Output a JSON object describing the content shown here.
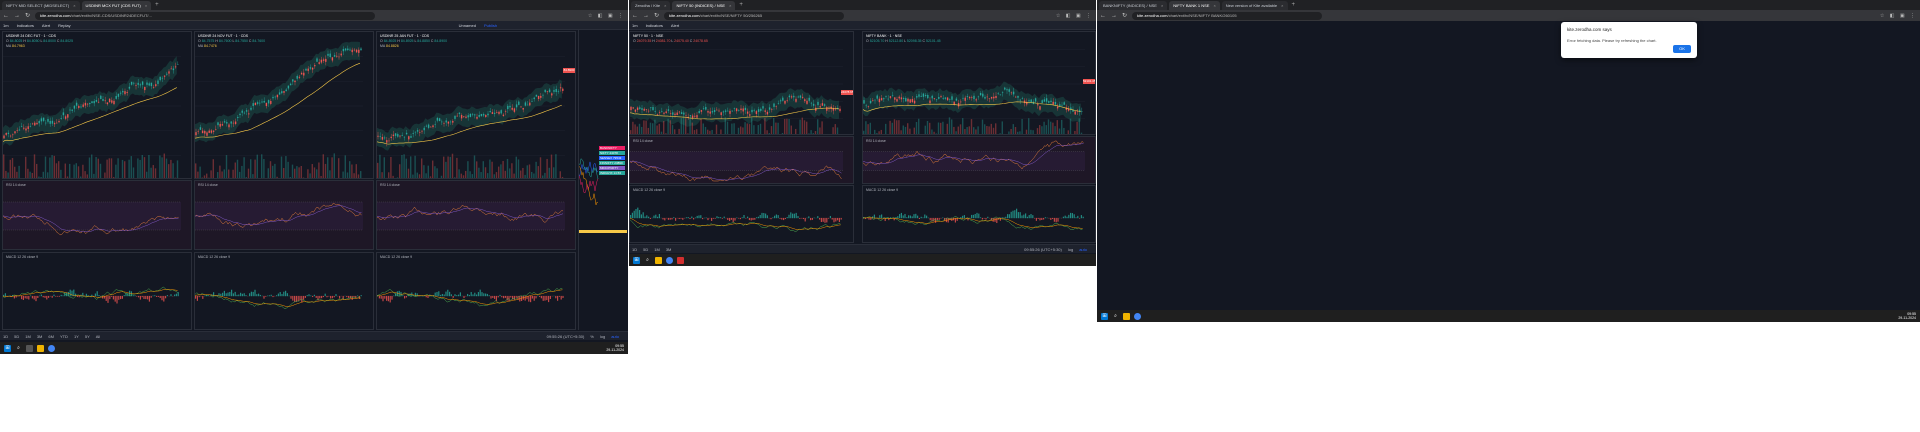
{
  "left_screen": {
    "tabs": [
      {
        "label": "NIFTY MID SELECT (MIDSELECT)",
        "active": false
      },
      {
        "label": "USDINR MCX FUT (CDS FUT)",
        "active": true
      }
    ],
    "url_domain": "kite.zerodha.com",
    "url_path": "/chart/ext/tv/NSE-CDS/USDINR24DECFUT/...",
    "toolbar": {
      "interval": "1m",
      "indicators": "Indicators",
      "alert": "Alert",
      "replay": "Replay",
      "layout": "Unnamed",
      "publish": "Publish"
    },
    "charts": [
      {
        "symbol": "USDINR 24 DEC FUT · 1 · CDS",
        "o": "84.8025",
        "h": "84.8050",
        "l": "84.8000",
        "c": "84.8025",
        "ma": "84.7963",
        "price_tag": "84.8025"
      },
      {
        "symbol": "USDINR 24 NOV FUT · 1 · CDS",
        "o": "84.7575",
        "h": "84.7600",
        "l": "84.7550",
        "c": "84.7600",
        "ma": "84.7476",
        "price_tag": "84.7600"
      },
      {
        "symbol": "USDINR 25 JAN FUT · 1 · CDS",
        "o": "84.8925",
        "h": "84.8925",
        "l": "84.8850",
        "c": "84.8900",
        "ma": "84.8826",
        "price_tag": "84.8900"
      }
    ],
    "rsi_label": "RSI 14 close",
    "macd_label": "MACD 12 26 close 9",
    "bottom": {
      "ranges": [
        "1D",
        "5D",
        "1M",
        "3M",
        "6M",
        "YTD",
        "1Y",
        "5Y",
        "All"
      ],
      "time": "09:55:26 (UTC+5:30)",
      "pct": "%",
      "log": "log",
      "auto": "auto"
    },
    "clock": {
      "time": "09:55",
      "date": "29-11-2024"
    }
  },
  "middle_screen": {
    "tabs": [
      {
        "label": "Zerodha / Kite",
        "active": false
      },
      {
        "label": "NIFTY 50 (INDICES) / NSE",
        "active": true
      }
    ],
    "url_domain": "kite.zerodha.com",
    "url_path": "/chart/ext/tv/NSE/NIFTY 50/256265",
    "chart": {
      "symbol": "NIFTY 50 · 1 · NSE",
      "o": "24079.35",
      "h": "24081.70",
      "l": "24075.40",
      "c": "24078.65",
      "price_tag": "24078.65"
    },
    "bottom_time": "09:55:26 (UTC+5:30)"
  },
  "right_screen": {
    "tabs": [
      {
        "label": "BANKNIFTY (INDICES) / NSE",
        "active": false
      },
      {
        "label": "NIFTY BANK 1 NSE",
        "active": true
      },
      {
        "label": "New version of Kite available",
        "active": false
      }
    ],
    "url_domain": "kite.zerodha.com",
    "url_path": "/chart/ext/tv/NSE/NIFTY BANK/260105",
    "chart": {
      "symbol": "NIFTY BANK · 1 · NSE",
      "o": "52105.70",
      "h": "52112.80",
      "l": "52098.35",
      "c": "52101.45",
      "price_tag": "52101.45"
    },
    "bottom_time": "09:55:26 (UTC+5:30)",
    "dialog": {
      "title": "kite.zerodha.com says",
      "message": "Error fetching data. Please try refreshing the chart.",
      "ok": "OK"
    },
    "clock": {
      "time": "09:55",
      "date": "29-11-2024"
    }
  },
  "watchlist": {
    "chips": [
      {
        "label": "BANKNIFTY 52101",
        "color": "#e91e63"
      },
      {
        "label": "NIFTY 24078",
        "color": "#26a69a"
      },
      {
        "label": "SENSEX 79543",
        "color": "#2962ff"
      },
      {
        "label": "FINNIFTY 23890",
        "color": "#26a69a"
      },
      {
        "label": "MIDCPNIFTY 12470",
        "color": "#7e57c2"
      },
      {
        "label": "INDIAVIX 14.53",
        "color": "#26a69a"
      }
    ]
  },
  "colors": {
    "up": "#26a69a",
    "down": "#ef5350",
    "ma": "#f7c948",
    "bg": "#131722",
    "rsi_bg": "#2a1d33"
  }
}
